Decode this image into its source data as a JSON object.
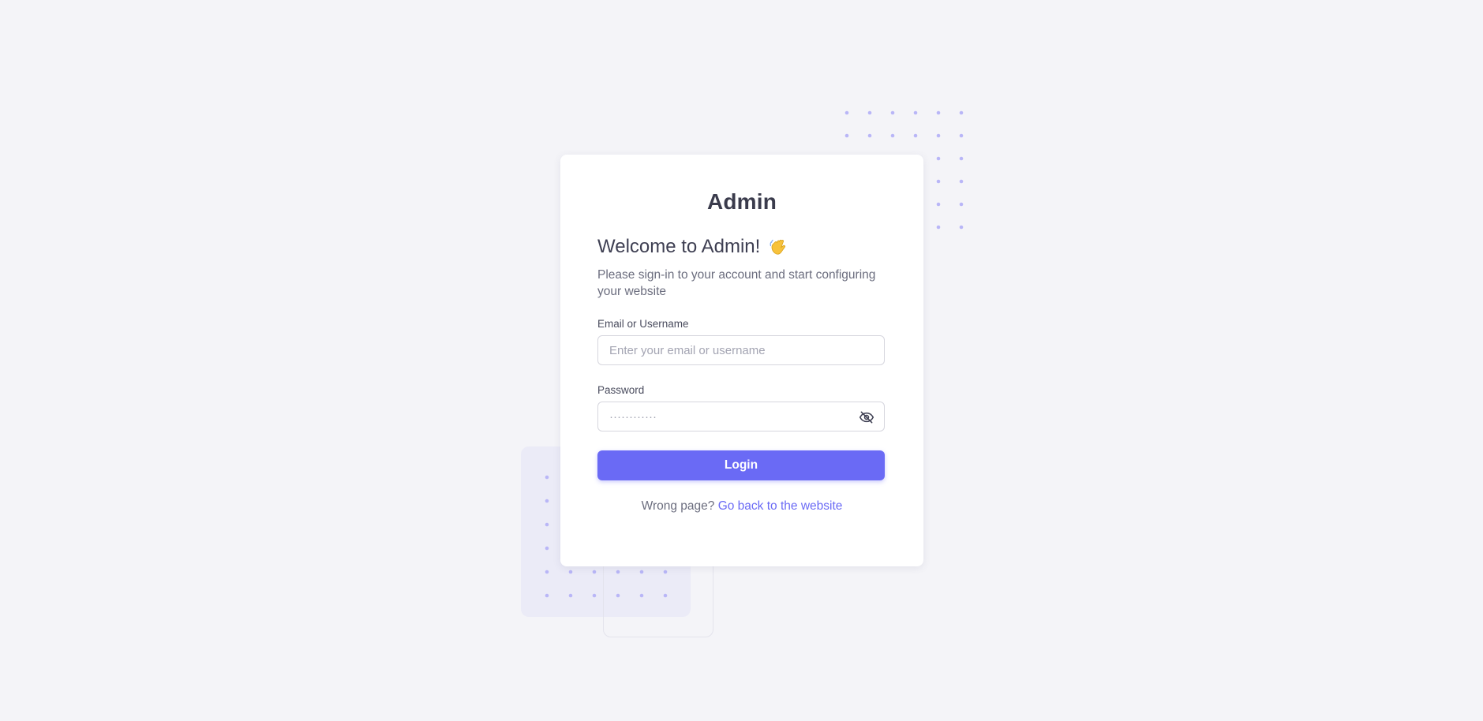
{
  "brand": "Admin",
  "welcome": {
    "title": "Welcome to Admin!",
    "icon": "waving-hand-icon",
    "subtitle": "Please sign-in to your account and start configuring your website"
  },
  "form": {
    "email_label": "Email or Username",
    "email_placeholder": "Enter your email or username",
    "email_value": "",
    "password_label": "Password",
    "password_placeholder": "············",
    "password_value": "",
    "password_toggle_icon": "eye-off-icon",
    "login_label": "Login"
  },
  "footer": {
    "text": "Wrong page?",
    "link_label": "Go back to the website"
  },
  "colors": {
    "accent": "#6a6af5",
    "background": "#f4f4f8",
    "decor_dots": "#b9b6f7"
  }
}
